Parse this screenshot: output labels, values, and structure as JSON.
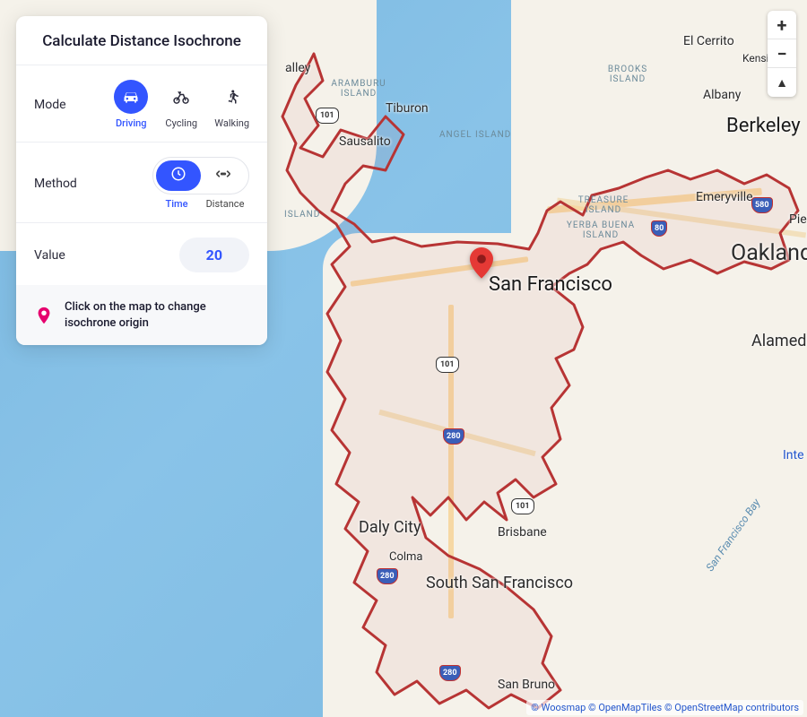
{
  "panel": {
    "title": "Calculate Distance Isochrone",
    "mode": {
      "label": "Mode",
      "options": [
        {
          "key": "driving",
          "label": "Driving",
          "icon": "car-icon"
        },
        {
          "key": "cycling",
          "label": "Cycling",
          "icon": "bicycle-icon"
        },
        {
          "key": "walking",
          "label": "Walking",
          "icon": "walk-icon"
        }
      ],
      "selected": "driving"
    },
    "method": {
      "label": "Method",
      "options": [
        {
          "key": "time",
          "label": "Time",
          "icon": "clock-icon"
        },
        {
          "key": "distance",
          "label": "Distance",
          "icon": "expand-icon"
        }
      ],
      "selected": "time"
    },
    "value": {
      "label": "Value",
      "value": "20"
    },
    "hint": "Click on the map to change isochrone origin"
  },
  "zoom": {
    "in": "+",
    "out": "−",
    "compass": "▲"
  },
  "map": {
    "cities": {
      "san_francisco": "San Francisco",
      "oakland": "Oakland",
      "berkeley": "Berkeley",
      "daly_city": "Daly City",
      "south_sf": "South San Francisco",
      "brisbane": "Brisbane",
      "san_bruno": "San Bruno",
      "colma": "Colma",
      "sausalito": "Sausalito",
      "tiburon": "Tiburon",
      "alameda": "Alameda",
      "emeryville": "Emeryville",
      "albany": "Albany",
      "el_cerrito": "El Cerrito",
      "kensington": "Kensington",
      "piedmont": "Pie",
      "valley_suffix": "alley",
      "interstate_island": "Inte"
    },
    "islands": {
      "angel": "ANGEL ISLAND",
      "treasure": "TREASURE ISLAND",
      "yerba": "YERBA BUENA ISLAND",
      "brooks": "BROOKS ISLAND",
      "aramburu": "ARAMBURU ISLAND",
      "island_suffix": "ISLAND"
    },
    "water": {
      "sf_bay": "San Francisco Bay"
    },
    "shields": {
      "us101_a": "101",
      "us101_b": "101",
      "us101_c": "101",
      "i280_a": "280",
      "i280_b": "280",
      "i280_c": "280",
      "i80": "80",
      "i580": "580"
    }
  },
  "attribution": {
    "woosmap": "© Woosmap",
    "omt": "© OpenMapTiles",
    "osm": "© OpenStreetMap contributors"
  },
  "colors": {
    "primary": "#3355ff",
    "isochrone_stroke": "#b73434",
    "marker": "#e53935",
    "water": "#7bb8e0",
    "land": "#f5f2ea"
  }
}
